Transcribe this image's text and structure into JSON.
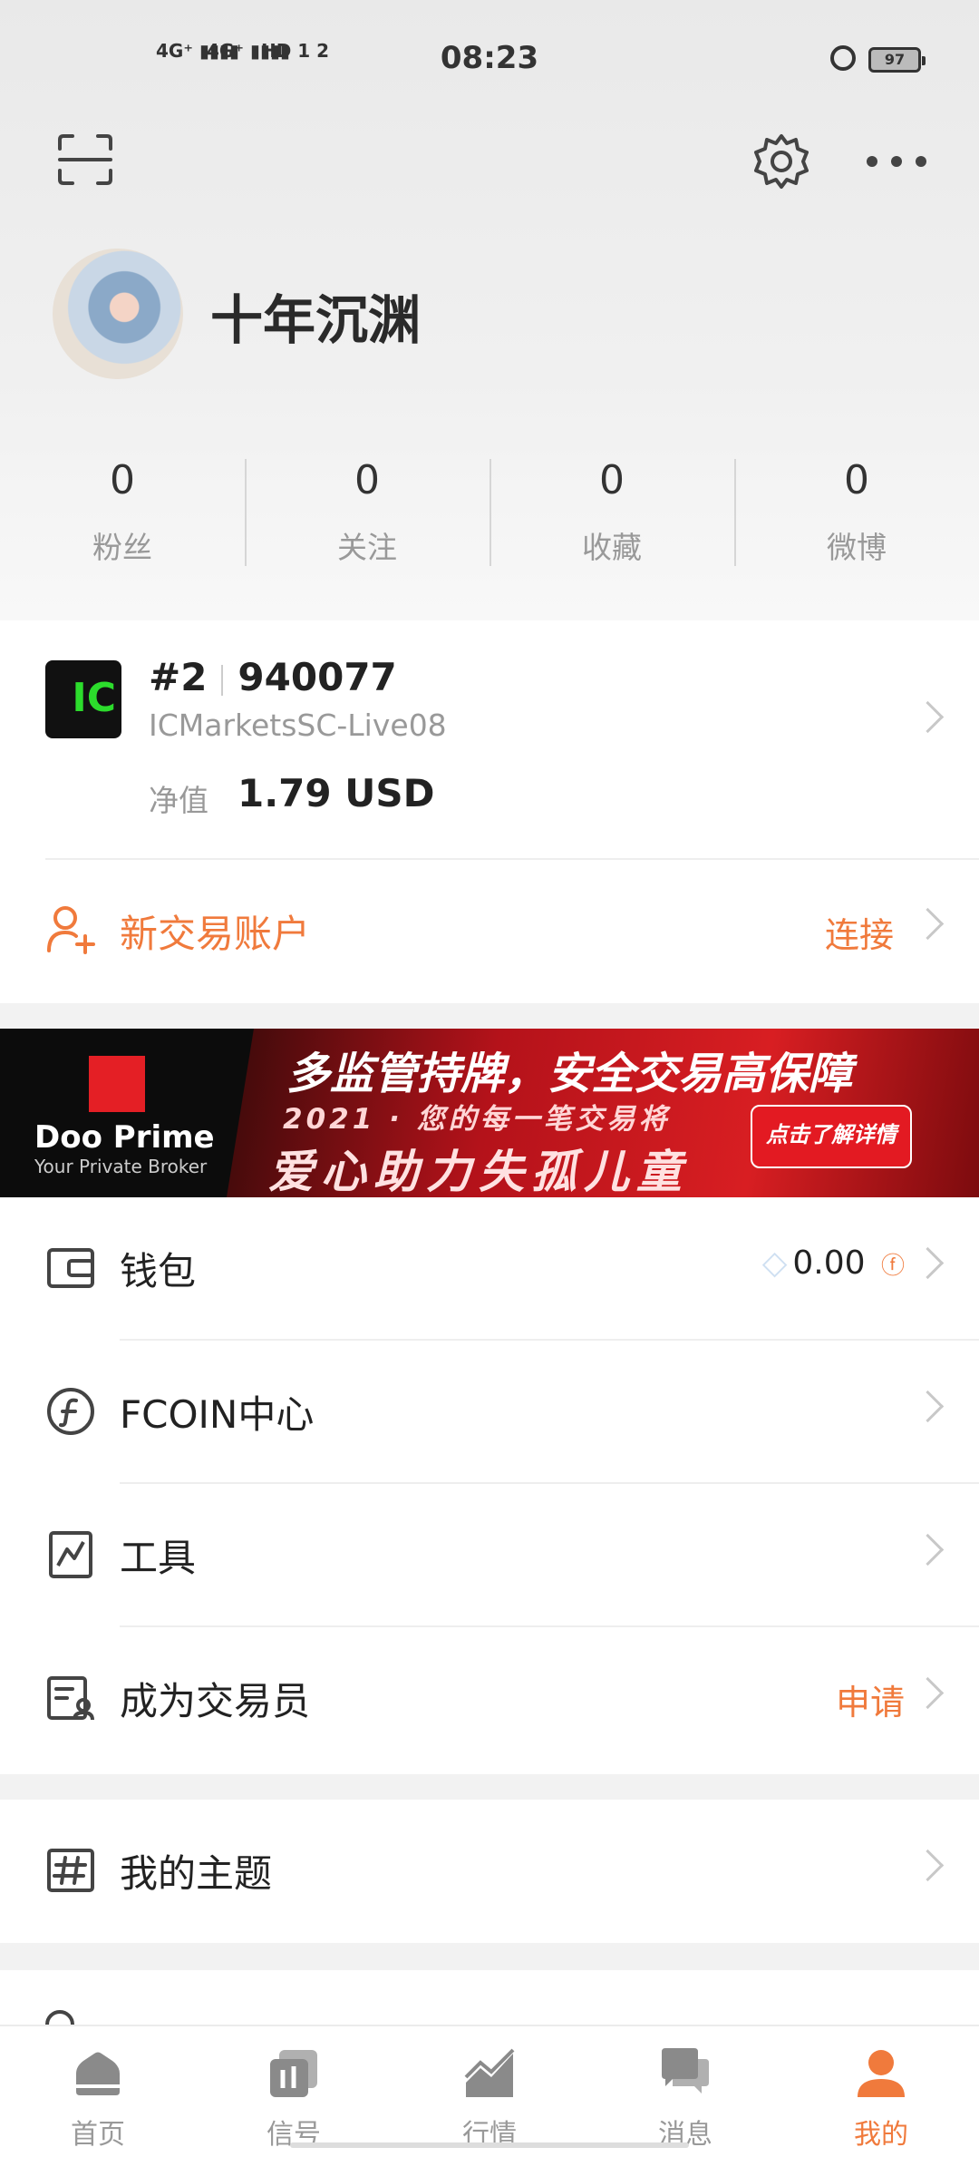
{
  "status_bar": {
    "signal1": "4G⁺ ▮▮▮▮",
    "signal2": "4G⁺ ▮▮▮▮",
    "hd": "HD 1 2",
    "time": "08:23",
    "battery": "97"
  },
  "profile": {
    "username": "十年沉渊",
    "stats": [
      {
        "value": "0",
        "label": "粉丝"
      },
      {
        "value": "0",
        "label": "关注"
      },
      {
        "value": "0",
        "label": "收藏"
      },
      {
        "value": "0",
        "label": "微博"
      }
    ]
  },
  "account": {
    "logo_text": "IC",
    "index": "#2",
    "number": "940077",
    "server": "ICMarketsSC-Live08",
    "equity_label": "净值",
    "equity_value": "1.79 USD",
    "new_account_label": "新交易账户",
    "connect_label": "连接"
  },
  "banner": {
    "brand": "Doo Prime",
    "tagline": "Your Private Broker",
    "headline": "多监管持牌，安全交易高保障",
    "subline": "2021 · 您的每一笔交易将",
    "slogan": "爱心助力失孤儿童",
    "cta": "点击了解详情"
  },
  "menu": {
    "wallet": {
      "label": "钱包",
      "balance": "0.00"
    },
    "fcoin": {
      "label": "FCOIN中心"
    },
    "tools": {
      "label": "工具"
    },
    "trader": {
      "label": "成为交易员",
      "action": "申请"
    },
    "theme": {
      "label": "我的主题"
    }
  },
  "tabs": [
    {
      "label": "首页",
      "icon": "home-icon"
    },
    {
      "label": "信号",
      "icon": "signal-icon"
    },
    {
      "label": "行情",
      "icon": "market-icon"
    },
    {
      "label": "消息",
      "icon": "message-icon"
    },
    {
      "label": "我的",
      "icon": "profile-icon",
      "active": true
    }
  ],
  "colors": {
    "accent": "#f07a3c",
    "brand_red": "#e41f25"
  }
}
